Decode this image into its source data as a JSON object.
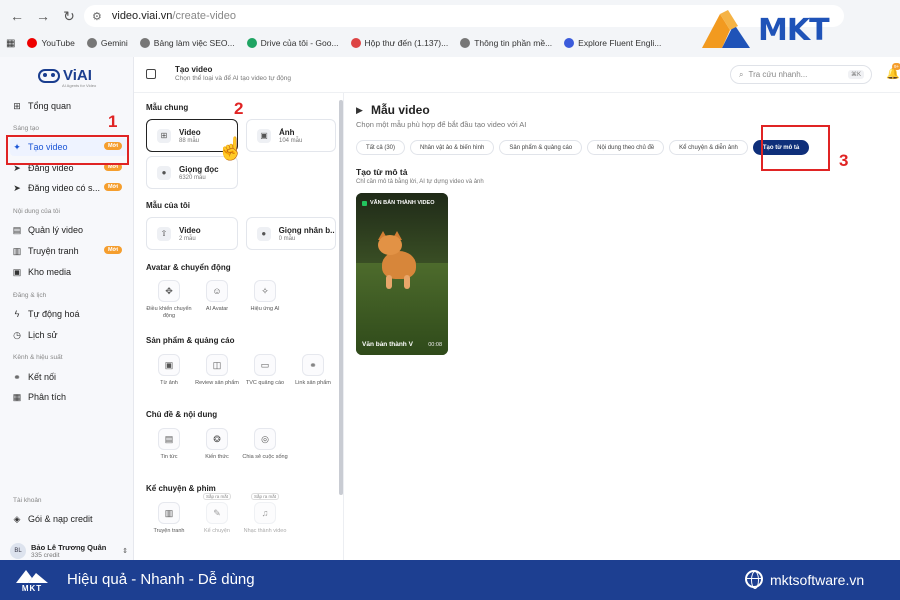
{
  "browser": {
    "url_domain": "video.viai.vn",
    "url_path": "/create-video",
    "bookmarks": [
      {
        "label": "YouTube",
        "color": "#e00"
      },
      {
        "label": "Gemini",
        "color": "#666"
      },
      {
        "label": "Bảng làm việc SEO...",
        "color": "#666"
      },
      {
        "label": "Drive của tôi - Goo...",
        "color": "#1fa463"
      },
      {
        "label": "Hộp thư đến (1.137)...",
        "color": "#d44"
      },
      {
        "label": "Thông tin phần mề...",
        "color": "#666"
      },
      {
        "label": "Explore Fluent Engli...",
        "color": "#3b5bdb"
      },
      {
        "label": "",
        "color": "#fff"
      }
    ],
    "right_bookmark_1": "Ệ SEO",
    "right_bookmark_2": "TUYỂN TIN T"
  },
  "brand_overlay": {
    "name": "MKT",
    "color": "#1f53b8"
  },
  "sidebar": {
    "logo_name": "ViAI",
    "logo_sub": "AI Agents for Video",
    "overview": "Tổng quan",
    "sec_create": "Sáng tạo",
    "create_video": "Tạo video",
    "post_video": "Đăng video",
    "post_video_alt": "Đăng video có s...",
    "badge_new": "Mới",
    "sec_content": "Nội dung của tôi",
    "manage_video": "Quản lý video",
    "comics": "Truyện tranh",
    "media": "Kho media",
    "sec_schedule": "Đăng & lịch",
    "automation": "Tự động hoá",
    "history": "Lịch sử",
    "sec_channels": "Kênh & hiệu suất",
    "connect": "Kết nối",
    "analytics": "Phân tích",
    "sec_account": "Tài khoản",
    "plans": "Gói & nạp credit",
    "user_initials": "BL",
    "user_name": "Bảo Lê Trương Quân",
    "user_credit": "335 credit"
  },
  "annotations": {
    "n1": "1",
    "n2": "2",
    "n3": "3"
  },
  "topbar": {
    "title": "Tạo video",
    "subtitle": "Chọn thể loại và để AI tạo video tự động",
    "search_placeholder": "Tra cứu nhanh...",
    "search_kbd": "⌘K",
    "notif_count": "9+"
  },
  "mid": {
    "sec_common": "Mẫu chung",
    "video_title": "Video",
    "video_count": "88 mẫu",
    "image_title": "Ảnh",
    "image_count": "104 mẫu",
    "voice_title": "Giọng đọc",
    "voice_count": "6320 mẫu",
    "sec_mine": "Mẫu của tôi",
    "my_video_title": "Video",
    "my_video_count": "2 mẫu",
    "my_voice_title": "Giọng nhân b...",
    "my_voice_count": "0 mẫu",
    "sec_avatar": "Avatar & chuyển động",
    "t_motion": "Điều khiển chuyển động",
    "t_avatar": "AI Avatar",
    "t_effect": "Hiệu ứng AI",
    "sec_product": "Sản phẩm & quảng cáo",
    "t_from_image": "Từ ảnh",
    "t_review": "Review sản phẩm",
    "t_tvc": "TVC quảng cáo",
    "t_link": "Link sản phẩm",
    "sec_topic": "Chủ đề & nội dung",
    "t_news": "Tin tức",
    "t_knowledge": "Kiến thức",
    "t_life": "Chia sẻ cuộc sống",
    "sec_story": "Kể chuyện & phim",
    "t_story": "Truyện tranh",
    "t_tell": "Kể chuyện",
    "t_music": "Nhạc thành video",
    "soon": "Sắp ra mắt"
  },
  "main": {
    "title": "Mẫu video",
    "subtitle": "Chọn một mẫu phù hợp để bắt đầu tạo video với AI",
    "filters": [
      "Tất cả (30)",
      "Nhân vật ảo & biến hình",
      "Sản phẩm & quảng cáo",
      "Nội dung theo chủ đề",
      "Kể chuyện & diễn ảnh",
      "Tạo từ mô tả"
    ],
    "sec_title": "Tạo từ mô tả",
    "sec_sub": "Chỉ cần mô tả bằng lời, AI tự dựng video và ảnh",
    "card_tag": "VĂN BẢN THÀNH VIDEO",
    "card_name": "Văn bản thành V",
    "card_duration": "00:08"
  },
  "footer": {
    "logo": "MKT",
    "tagline": "Hiệu quả - Nhanh - Dễ dùng",
    "website": "mktsoftware.vn"
  }
}
